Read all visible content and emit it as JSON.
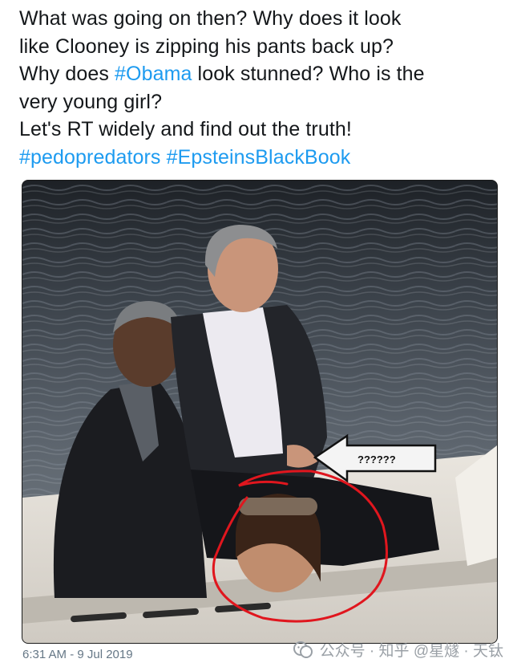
{
  "tweet": {
    "lines": [
      {
        "parts": [
          {
            "text": "What was going on then? Why does it look",
            "type": "text"
          }
        ]
      },
      {
        "parts": [
          {
            "text": "like Clooney is zipping his pants back up?",
            "type": "text"
          }
        ]
      },
      {
        "parts": [
          {
            "text": "Why does ",
            "type": "text"
          },
          {
            "text": "#Obama",
            "type": "hashtag"
          },
          {
            "text": " look stunned? Who is the",
            "type": "text"
          }
        ]
      },
      {
        "parts": [
          {
            "text": "very young girl?",
            "type": "text"
          }
        ]
      },
      {
        "parts": [
          {
            "text": "Let's RT widely and find out the truth!",
            "type": "text"
          }
        ]
      },
      {
        "parts": [
          {
            "text": "#pedopredators",
            "type": "hashtag"
          },
          {
            "text": " ",
            "type": "text"
          },
          {
            "text": "#EpsteinsBlackBook",
            "type": "hashtag"
          }
        ]
      }
    ],
    "hashtag_color": "#1d9bf0"
  },
  "photo": {
    "arrow_label": "??????",
    "circle_color": "#e0161e"
  },
  "timestamp": "6:31 AM - 9 Jul 2019",
  "watermark": {
    "text": "公众号 · 知乎 @星燧 · 天钛",
    "icon": "wechat-icon"
  }
}
